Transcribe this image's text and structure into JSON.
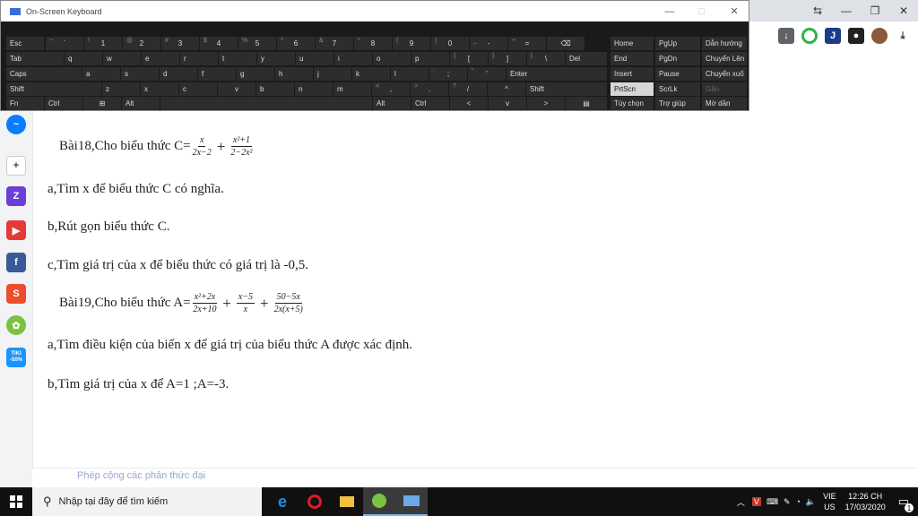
{
  "osk": {
    "title": "On-Screen Keyboard",
    "win_minimize": "—",
    "win_maximize": "□",
    "win_close": "✕",
    "rows": [
      [
        [
          "Esc",
          ""
        ],
        [
          "`",
          "~"
        ],
        [
          "1",
          "!"
        ],
        [
          "2",
          "@"
        ],
        [
          "3",
          "#"
        ],
        [
          "4",
          "$"
        ],
        [
          "5",
          "%"
        ],
        [
          "6",
          "^"
        ],
        [
          "7",
          "&"
        ],
        [
          "8",
          "*"
        ],
        [
          "9",
          "("
        ],
        [
          "0",
          ")"
        ],
        [
          "-",
          "_"
        ],
        [
          "=",
          "+"
        ],
        [
          "⌫",
          ""
        ]
      ],
      [
        [
          "Tab",
          ""
        ],
        [
          "q",
          ""
        ],
        [
          "w",
          ""
        ],
        [
          "e",
          ""
        ],
        [
          "r",
          ""
        ],
        [
          "t",
          ""
        ],
        [
          "y",
          ""
        ],
        [
          "u",
          ""
        ],
        [
          "i",
          ""
        ],
        [
          "o",
          ""
        ],
        [
          "p",
          ""
        ],
        [
          "[",
          "{"
        ],
        [
          "]",
          "}"
        ],
        [
          "\\",
          "|"
        ],
        [
          "Del",
          ""
        ]
      ],
      [
        [
          "Caps",
          ""
        ],
        [
          "a",
          ""
        ],
        [
          "s",
          ""
        ],
        [
          "d",
          ""
        ],
        [
          "f",
          ""
        ],
        [
          "g",
          ""
        ],
        [
          "h",
          ""
        ],
        [
          "j",
          ""
        ],
        [
          "k",
          ""
        ],
        [
          "l",
          ""
        ],
        [
          ";",
          ":"
        ],
        [
          "'",
          "\""
        ],
        [
          "Enter",
          ""
        ]
      ],
      [
        [
          "Shift",
          ""
        ],
        [
          "z",
          ""
        ],
        [
          "x",
          ""
        ],
        [
          "c",
          ""
        ],
        [
          "v",
          ""
        ],
        [
          "b",
          ""
        ],
        [
          "n",
          ""
        ],
        [
          "m",
          ""
        ],
        [
          ",",
          "<"
        ],
        [
          ".",
          ">"
        ],
        [
          "/",
          "?"
        ],
        [
          "^",
          ""
        ],
        [
          "Shift",
          ""
        ]
      ],
      [
        [
          "Fn",
          ""
        ],
        [
          "Ctrl",
          ""
        ],
        [
          "⊞",
          ""
        ],
        [
          "Alt",
          ""
        ],
        [
          "",
          ""
        ],
        [
          "Alt",
          ""
        ],
        [
          "Ctrl",
          ""
        ],
        [
          "<",
          ""
        ],
        [
          "v",
          ""
        ],
        [
          ">",
          ""
        ],
        [
          "▤",
          ""
        ]
      ]
    ],
    "nav": [
      [
        "Home",
        "PgUp",
        "Dẫn hướng"
      ],
      [
        "End",
        "PgDn",
        "Chuyển Lên"
      ],
      [
        "Insert",
        "Pause",
        "Chuyển xuố"
      ],
      [
        "PrtScn",
        "ScrLk",
        "Gắn"
      ],
      [
        "Tùy chọn",
        "Trợ giúp",
        "Mờ dần"
      ]
    ]
  },
  "document": {
    "bai18_label": "Bài18,Cho biểu thức C=",
    "bai18_f1_num": "x",
    "bai18_f1_den": "2x−2",
    "bai18_f2_num": "x²+1",
    "bai18_f2_den": "2−2x²",
    "line_a18": "a,Tìm x để biểu thức C có nghĩa.",
    "line_b18": "b,Rút gọn biểu thức C.",
    "line_c18": "c,Tìm giá trị của x để biểu thức có giá trị là -0,5.",
    "bai19_label": "Bài19,Cho biểu thức A=",
    "bai19_f1_num": "x²+2x",
    "bai19_f1_den": "2x+10",
    "bai19_f2_num": "x−5",
    "bai19_f2_den": "x",
    "bai19_f3_num": "50−5x",
    "bai19_f3_den": "2x(x+5)",
    "line_a19": "a,Tìm điều kiện của biến x để giá trị của biểu thức A được xác định.",
    "line_b19": "b,Tìm giá trị của x để A=1 ;A=-3.",
    "plus": "+",
    "ghost_text": "Phép cộng các phân thức đại"
  },
  "sidebar": {
    "add": "+",
    "zalo": "Z",
    "tiki": "TIKI -50%"
  },
  "taskbar": {
    "search_placeholder": "Nhập tại đây để tìm kiếm",
    "lang_top": "VIE",
    "lang_bottom": "US",
    "time": "12:26 CH",
    "date": "17/03/2020",
    "notif_count": "1"
  }
}
